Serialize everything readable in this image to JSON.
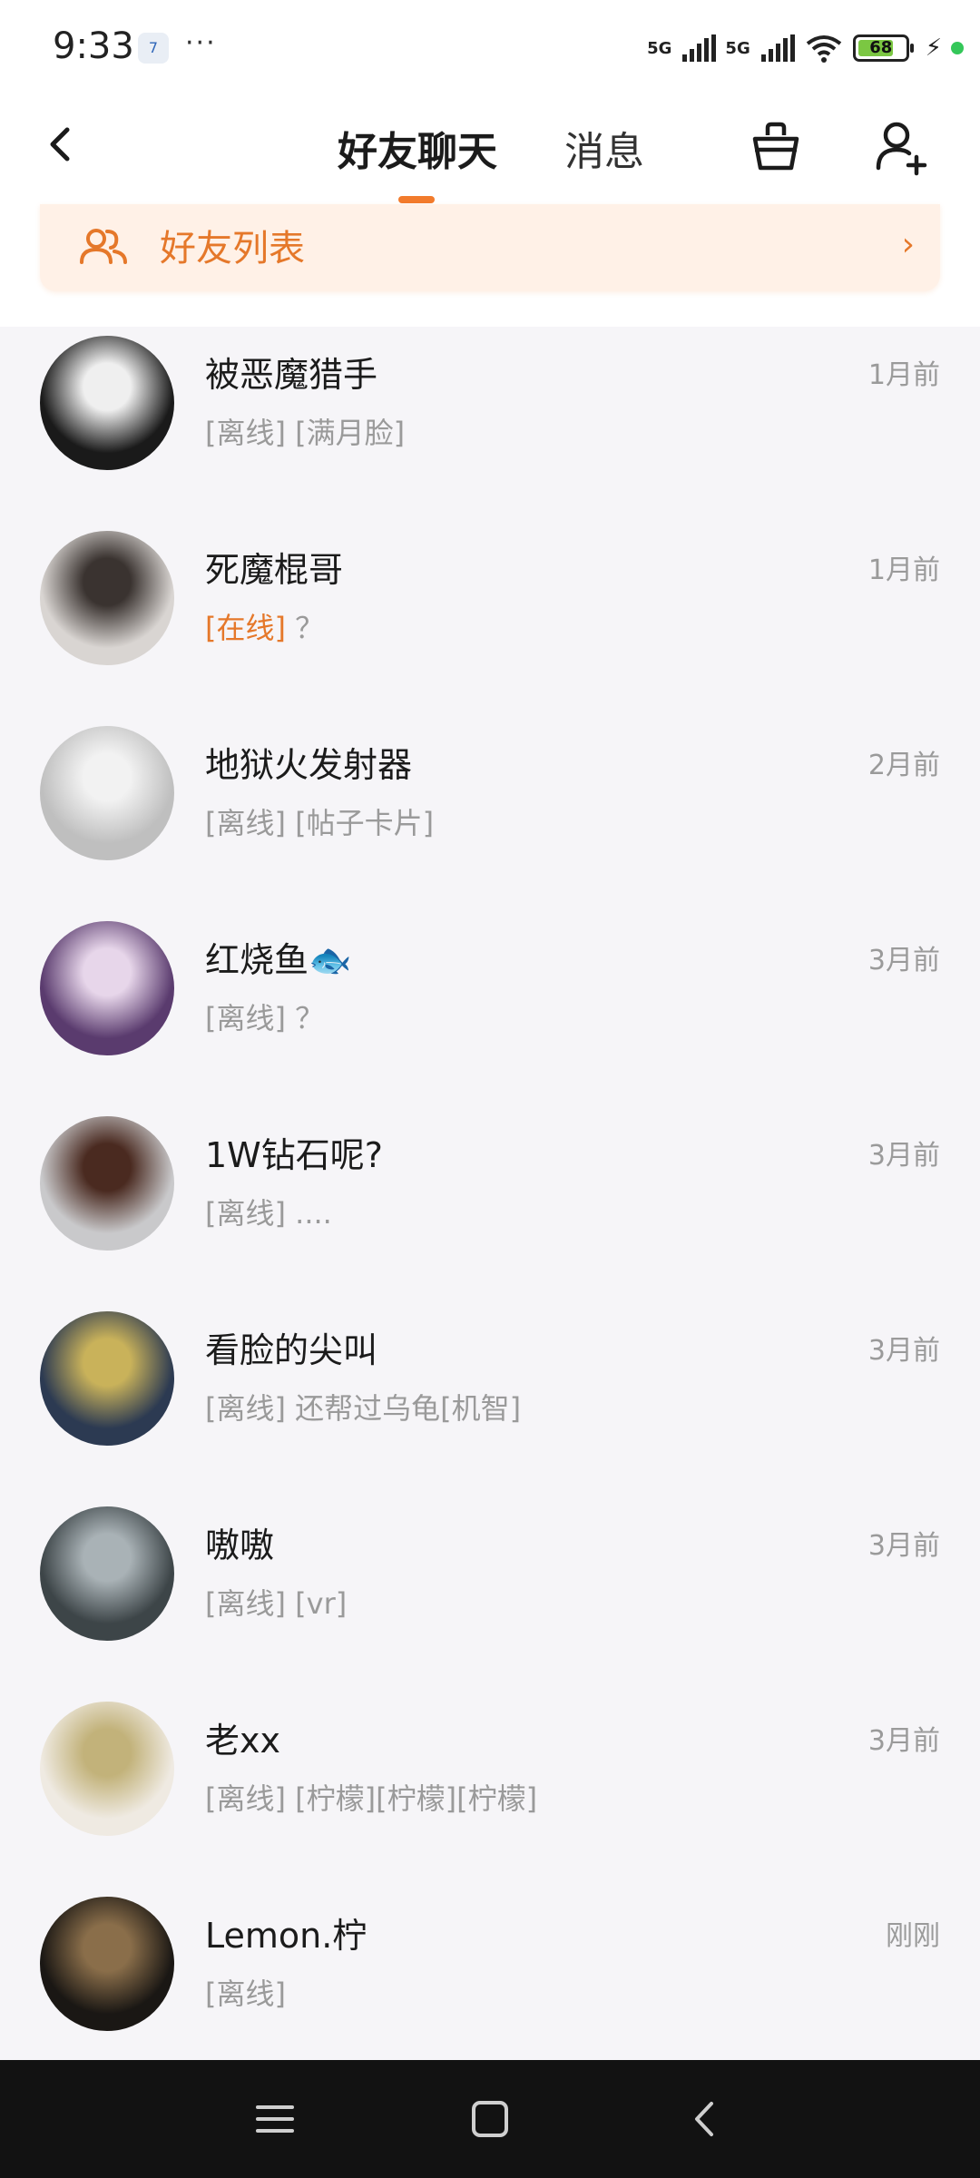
{
  "status_bar": {
    "time": "9:33",
    "calendar_day": "7",
    "more": "···",
    "network1": "5G",
    "network2": "5G",
    "battery": "68"
  },
  "header": {
    "tab_active": "好友聊天",
    "tab_inactive": "消息"
  },
  "banner": {
    "label": "好友列表",
    "chevron": "›"
  },
  "friends": [
    {
      "name": "被恶魔猎手",
      "status": "[离线]",
      "message": " [满月脸]",
      "time": "1月前",
      "online": false,
      "avatar_colors": [
        "#1a1a1a",
        "#efefef"
      ]
    },
    {
      "name": "死魔棍哥",
      "status": "[在线]",
      "message": " ？",
      "time": "1月前",
      "online": true,
      "avatar_colors": [
        "#d9d5d2",
        "#3a3330"
      ]
    },
    {
      "name": "地狱火发射器",
      "status": "[离线]",
      "message": " [帖子卡片]",
      "time": "2月前",
      "online": false,
      "avatar_colors": [
        "#bfbfbf",
        "#f2f2f2"
      ]
    },
    {
      "name": "红烧鱼🐟",
      "status": "[离线]",
      "message": " ？",
      "time": "3月前",
      "online": false,
      "avatar_colors": [
        "#5a3b6e",
        "#e7d6ea"
      ]
    },
    {
      "name": "1W钻石呢?",
      "status": "[离线]",
      "message": " ....",
      "time": "3月前",
      "online": false,
      "avatar_colors": [
        "#c9c9cb",
        "#4a2a20"
      ]
    },
    {
      "name": "看脸的尖叫",
      "status": "[离线]",
      "message": " 还帮过乌龟[机智]",
      "time": "3月前",
      "online": false,
      "avatar_colors": [
        "#2c3a52",
        "#c9b25a"
      ]
    },
    {
      "name": "嗷嗷",
      "status": "[离线]",
      "message": " [vr]",
      "time": "3月前",
      "online": false,
      "avatar_colors": [
        "#3d4548",
        "#a9b2b6"
      ]
    },
    {
      "name": "老xx",
      "status": "[离线]",
      "message": " [柠檬][柠檬][柠檬]",
      "time": "3月前",
      "online": false,
      "avatar_colors": [
        "#efeae2",
        "#c2b27a"
      ]
    },
    {
      "name": "Lemon.柠",
      "status": "[离线]",
      "message": "",
      "time": "刚刚",
      "online": false,
      "avatar_colors": [
        "#1a1714",
        "#8a6e4a"
      ]
    }
  ],
  "colors": {
    "accent": "#f27b2c",
    "banner_bg": "#fff1e7",
    "page_bg": "#f6f5f8"
  }
}
